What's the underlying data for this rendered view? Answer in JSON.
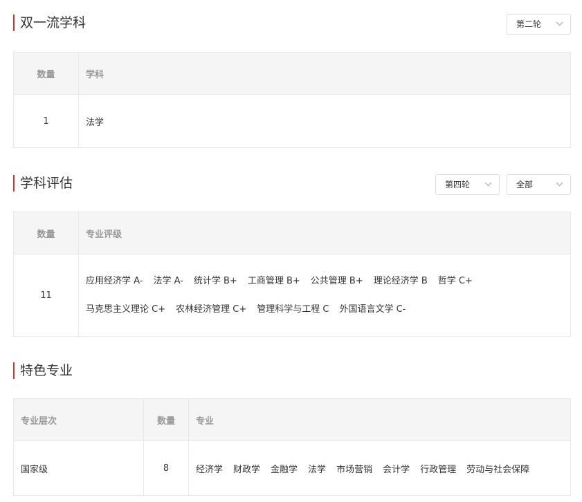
{
  "double_first_class": {
    "title": "双一流学科",
    "round_select": "第二轮",
    "headers": {
      "count": "数量",
      "subject": "学科"
    },
    "row": {
      "count": "1",
      "subject": "法学"
    }
  },
  "discipline_eval": {
    "title": "学科评估",
    "round_select": "第四轮",
    "filter_select": "全部",
    "headers": {
      "count": "数量",
      "grade": "专业评级"
    },
    "row": {
      "count": "11",
      "grades_line1": [
        "应用经济学 A-",
        "法学 A-",
        "统计学 B+",
        "工商管理 B+",
        "公共管理 B+",
        "理论经济学 B",
        "哲学 C+"
      ],
      "grades_line2": [
        "马克思主义理论 C+",
        "农林经济管理 C+",
        "管理科学与工程 C",
        "外国语言文学 C-"
      ]
    }
  },
  "featured_majors": {
    "title": "特色专业",
    "headers": {
      "level": "专业层次",
      "count": "数量",
      "major": "专业"
    },
    "row": {
      "level": "国家级",
      "count": "8",
      "majors": [
        "经济学",
        "财政学",
        "金融学",
        "法学",
        "市场营销",
        "会计学",
        "行政管理",
        "劳动与社会保障"
      ]
    }
  },
  "icons": {
    "dropdown": "chevron-down-icon"
  },
  "colors": {
    "accent_bar": "#d9342b",
    "header_bg": "#f5f5f5",
    "header_text": "#999999",
    "border": "#e8e8e8"
  }
}
